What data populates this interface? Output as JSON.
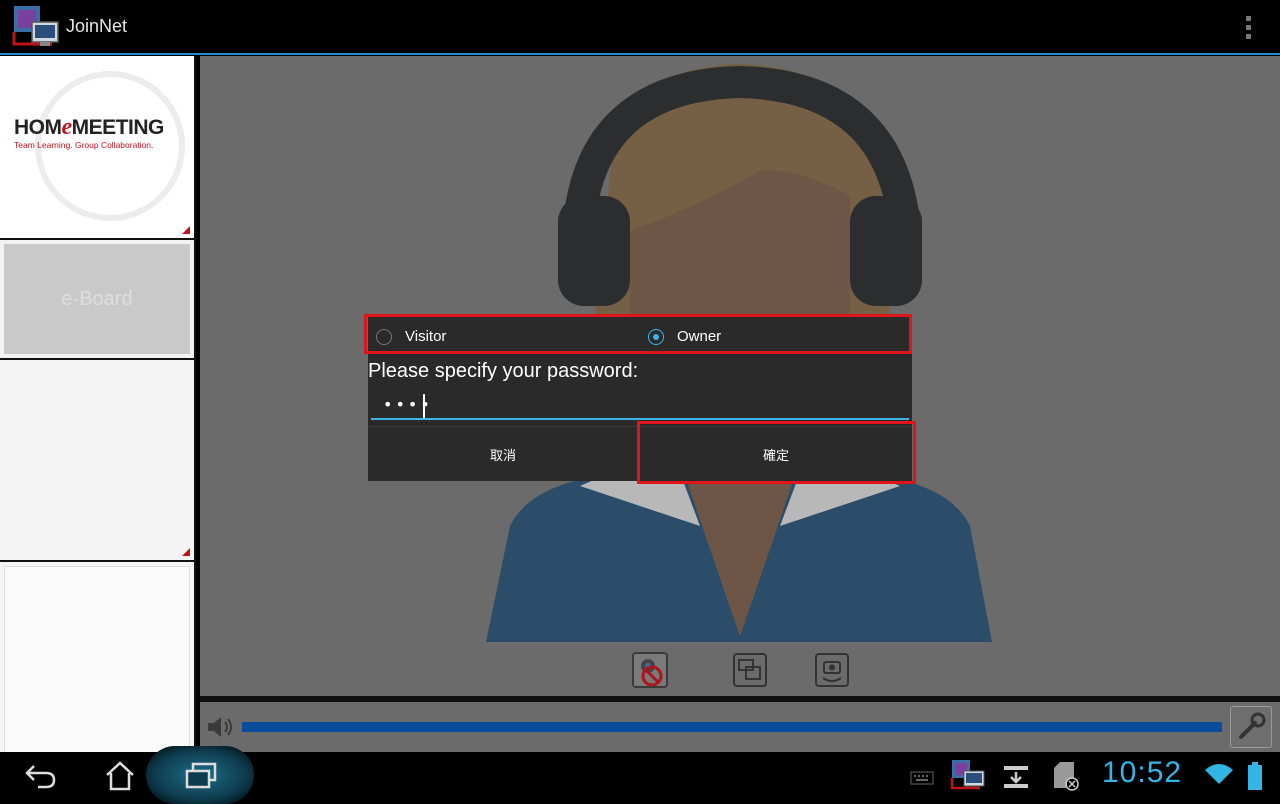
{
  "titlebar": {
    "title": "JoinNet"
  },
  "left_panel": {
    "logo_prefix": "HOM",
    "logo_e": "e",
    "logo_suffix": "MEETING",
    "logo_tagline": "Team Learning.  Group Collaboration.",
    "eboard_label": "e-Board"
  },
  "dialog": {
    "options": [
      {
        "label": "Visitor",
        "selected": false
      },
      {
        "label": "Owner",
        "selected": true
      }
    ],
    "prompt": "Please specify your password:",
    "password_value": "••••",
    "cancel_label": "取消",
    "ok_label": "確定"
  },
  "volume": {
    "level": 1.0
  },
  "statusbar": {
    "time": "10:52"
  },
  "colors": {
    "accent": "#33b5e5",
    "highlight": "#e0141b",
    "volume_bar": "#0a4c9c",
    "brand_red": "#c0141b"
  }
}
